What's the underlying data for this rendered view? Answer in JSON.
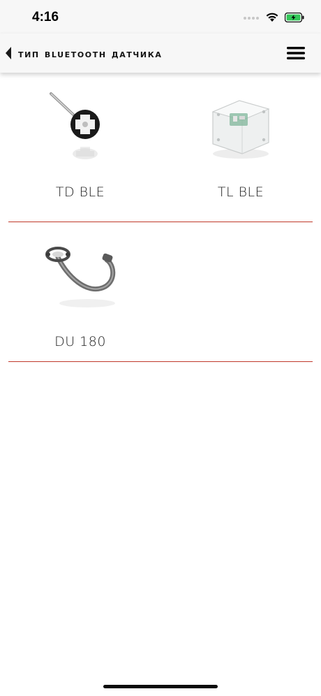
{
  "status_bar": {
    "time": "4:16"
  },
  "nav": {
    "title": "Тип bluetooth датчика"
  },
  "sensors": [
    {
      "label": "TD BLE",
      "icon": "td-ble-sensor-image"
    },
    {
      "label": "TL BLE",
      "icon": "tl-ble-sensor-image"
    },
    {
      "label": "DU 180",
      "icon": "du-180-sensor-image"
    }
  ],
  "colors": {
    "divider": "#c0392b",
    "battery": "#34c759",
    "bar_bg": "#f7f7f7"
  }
}
